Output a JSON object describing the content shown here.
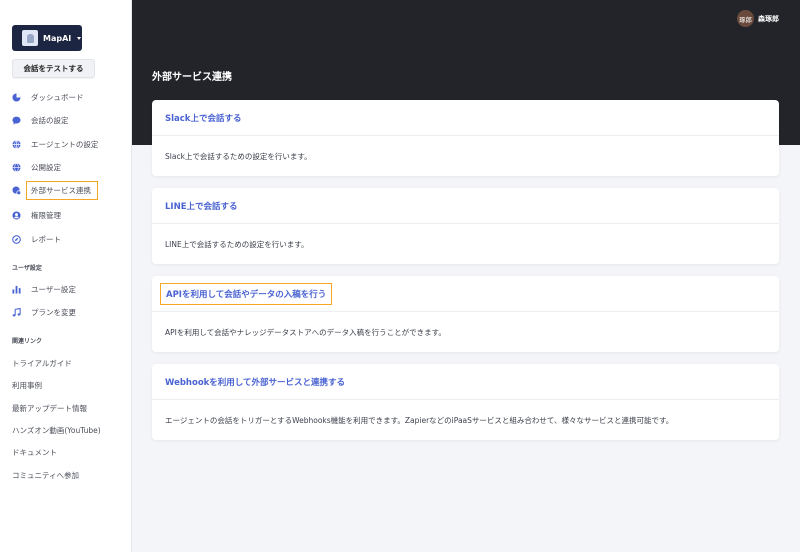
{
  "sidebar": {
    "brand": {
      "name": "MapAI"
    },
    "test_button": "会話をテストする",
    "nav": [
      {
        "label": "ダッシュボード",
        "icon": "dashboard-icon"
      },
      {
        "label": "会話の設定",
        "icon": "chat-bubble-icon"
      },
      {
        "label": "エージェントの設定",
        "icon": "globe-icon"
      },
      {
        "label": "公開設定",
        "icon": "globe-icon"
      },
      {
        "label": "外部サービス連携",
        "icon": "link-globe-icon",
        "active": true
      },
      {
        "label": "権限管理",
        "icon": "user-circle-icon"
      },
      {
        "label": "レポート",
        "icon": "compass-icon"
      }
    ],
    "user_section_label": "ユーザ設定",
    "user_nav": [
      {
        "label": "ユーザー設定",
        "icon": "bar-chart-icon"
      },
      {
        "label": "プランを変更",
        "icon": "music-note-icon"
      }
    ],
    "links_section_label": "関連リンク",
    "links": [
      "トライアルガイド",
      "利用事例",
      "最新アップデート情報",
      "ハンズオン動画(YouTube)",
      "ドキュメント",
      "コミュニティへ参加"
    ]
  },
  "header": {
    "page_title": "外部サービス連携",
    "user": {
      "avatar_text": "琢郎",
      "name": "森琢郎"
    }
  },
  "cards": [
    {
      "title": "Slack上で会話する",
      "description": "Slack上で会話するための設定を行います。"
    },
    {
      "title": "LINE上で会話する",
      "description": "LINE上で会話するための設定を行います。"
    },
    {
      "title": "APIを利用して会話やデータの入稿を行う",
      "description": "APIを利用して会話やナレッジデータストアへのデータ入稿を行うことができます。"
    },
    {
      "title": "Webhookを利用して外部サービスと連携する",
      "description": "エージェントの会話をトリガーとするWebhooks機能を利用できます。ZapierなどのiPaaSサービスと組み合わせて、様々なサービスと連携可能です。"
    }
  ],
  "colors": {
    "header_bg": "#222429",
    "brand_bg": "#1c2541",
    "link": "#4a63d2",
    "highlight": "#f5a623",
    "icon": "#4a63d2"
  }
}
